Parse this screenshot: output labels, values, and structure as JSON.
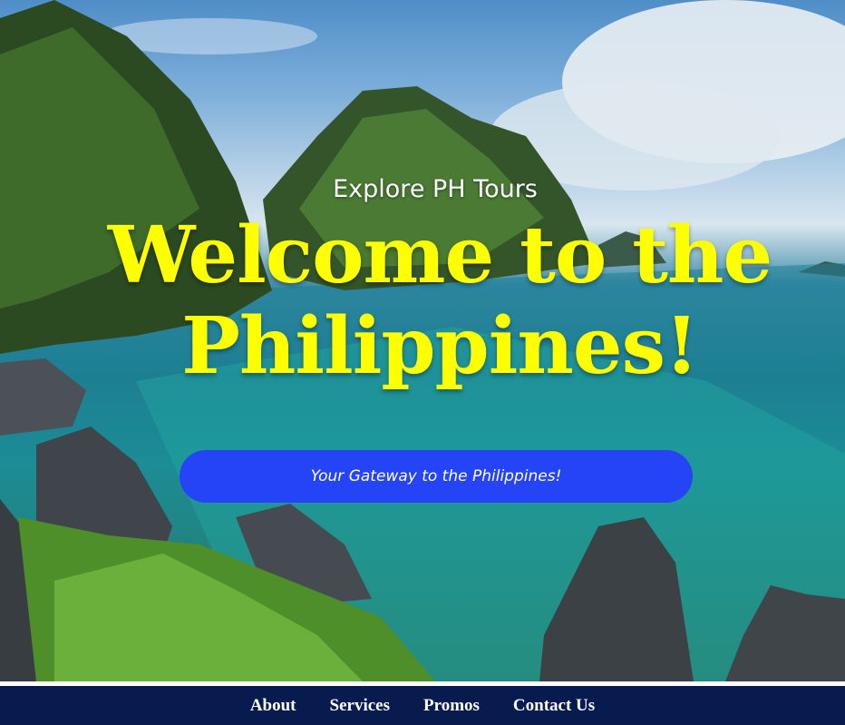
{
  "hero": {
    "brand": "Explore PH Tours",
    "headline": "Welcome to the Philippines!",
    "cta_label": "Your Gateway to the Philippines!"
  },
  "nav": {
    "items": [
      "About",
      "Services",
      "Promos",
      "Contact Us"
    ]
  },
  "colors": {
    "headline": "#ffff00",
    "cta_background": "#2444f5",
    "navbar_background": "#071b4f"
  }
}
